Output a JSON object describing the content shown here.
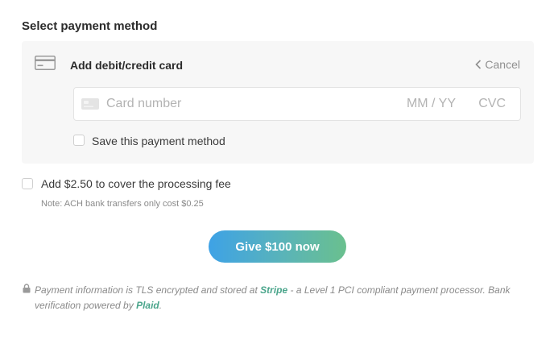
{
  "section_title": "Select payment method",
  "card_panel": {
    "heading": "Add debit/credit card",
    "cancel_label": "Cancel",
    "icon": "credit-card-icon",
    "input": {
      "card_number_placeholder": "Card number",
      "expiry_placeholder": "MM / YY",
      "cvc_placeholder": "CVC"
    },
    "save_label": "Save this payment method",
    "save_checked": false
  },
  "processing_fee": {
    "label": "Add $2.50 to cover the processing fee",
    "checked": false,
    "note": "Note: ACH bank transfers only cost $0.25"
  },
  "give_button": {
    "label": "Give $100 now"
  },
  "footer": {
    "text_1": "Payment information is TLS encrypted and stored at ",
    "stripe_link": "Stripe",
    "text_2": " - a Level 1 PCI compliant payment processor. Bank verification powered by ",
    "plaid_link": "Plaid",
    "text_3": "."
  },
  "colors": {
    "accent_green": "#4aa58b",
    "button_gradient_start": "#3ea2e6",
    "button_gradient_end": "#6ac08e",
    "panel_bg": "#f7f7f7"
  }
}
